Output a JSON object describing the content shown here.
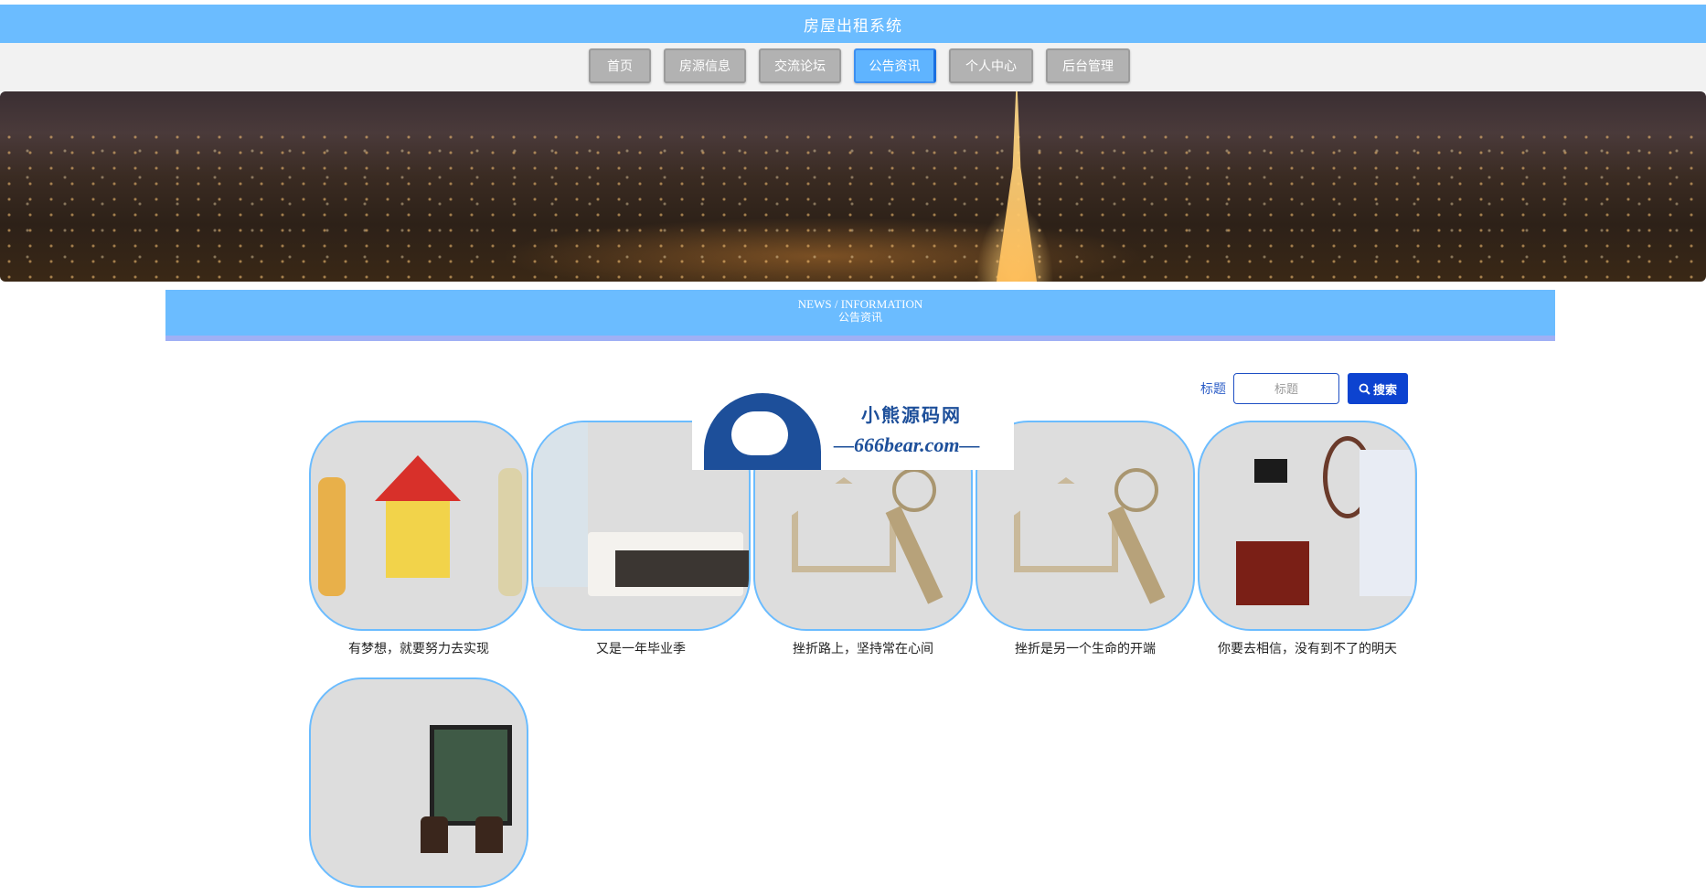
{
  "header": {
    "title": "房屋出租系统"
  },
  "nav": {
    "items": [
      {
        "label": "首页"
      },
      {
        "label": "房源信息"
      },
      {
        "label": "交流论坛"
      },
      {
        "label": "公告资讯",
        "active": true
      },
      {
        "label": "个人中心"
      },
      {
        "label": "后台管理"
      }
    ]
  },
  "section": {
    "en": "NEWS / INFORMATION",
    "cn": "公告资讯"
  },
  "search": {
    "label": "标题",
    "placeholder": "标题",
    "value": "",
    "button": "搜索"
  },
  "news": [
    {
      "caption": "有梦想，就要努力去实现"
    },
    {
      "caption": "又是一年毕业季"
    },
    {
      "caption": "挫折路上，坚持常在心间"
    },
    {
      "caption": "挫折是另一个生命的开端"
    },
    {
      "caption": "你要去相信，没有到不了的明天"
    },
    {
      "caption": ""
    }
  ],
  "watermark": {
    "line1": "小熊源码网",
    "line2": "—666bear.com—"
  },
  "colors": {
    "primary": "#6bbcff",
    "nav_inactive": "#b2b2b2",
    "search_button": "#0d43d0"
  }
}
